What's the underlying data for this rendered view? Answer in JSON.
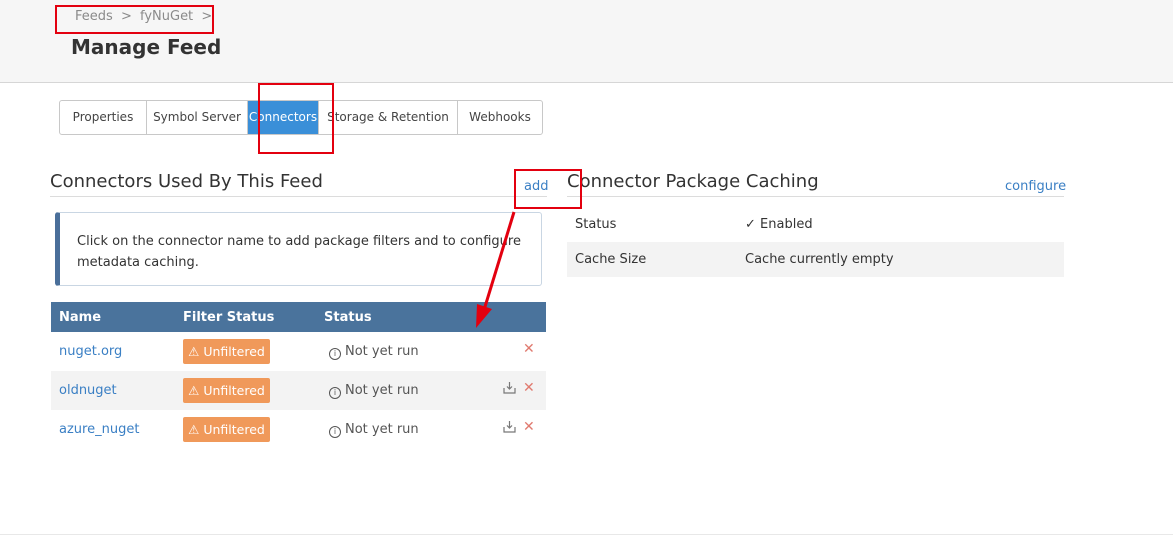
{
  "breadcrumb": {
    "item1": "Feeds",
    "sep1": ">",
    "item2": "fyNuGet",
    "sep2": ">"
  },
  "page_title": "Manage Feed",
  "tabs": [
    {
      "label": "Properties"
    },
    {
      "label": "Symbol Server"
    },
    {
      "label": "Connectors"
    },
    {
      "label": "Storage & Retention"
    },
    {
      "label": "Webhooks"
    }
  ],
  "active_tab": "Connectors",
  "connectors": {
    "title": "Connectors Used By This Feed",
    "add_link": "add",
    "info": "Click on the connector name to add package filters and to configure metadata caching.",
    "columns": [
      "Name",
      "Filter Status",
      "Status"
    ],
    "rows": [
      {
        "name": "nuget.org",
        "filter": "Unfiltered",
        "status": "Not yet run",
        "download_icon": false
      },
      {
        "name": "oldnuget",
        "filter": "Unfiltered",
        "status": "Not yet run",
        "download_icon": true
      },
      {
        "name": "azure_nuget",
        "filter": "Unfiltered",
        "status": "Not yet run",
        "download_icon": true
      }
    ]
  },
  "caching": {
    "title": "Connector Package Caching",
    "configure_link": "configure",
    "status_label": "Status",
    "status_value": "Enabled",
    "size_label": "Cache Size",
    "size_value": "Cache currently empty"
  },
  "icons": {
    "warning": "warning-triangle-icon",
    "info": "info-circle-icon",
    "download": "download-icon",
    "delete": "close-x-icon",
    "check": "check-icon"
  },
  "colors": {
    "accent": "#3a8fd8",
    "table_header": "#4a739c",
    "badge": "#f0995a",
    "annotation": "#e3000f",
    "enabled": "#4caf50"
  }
}
